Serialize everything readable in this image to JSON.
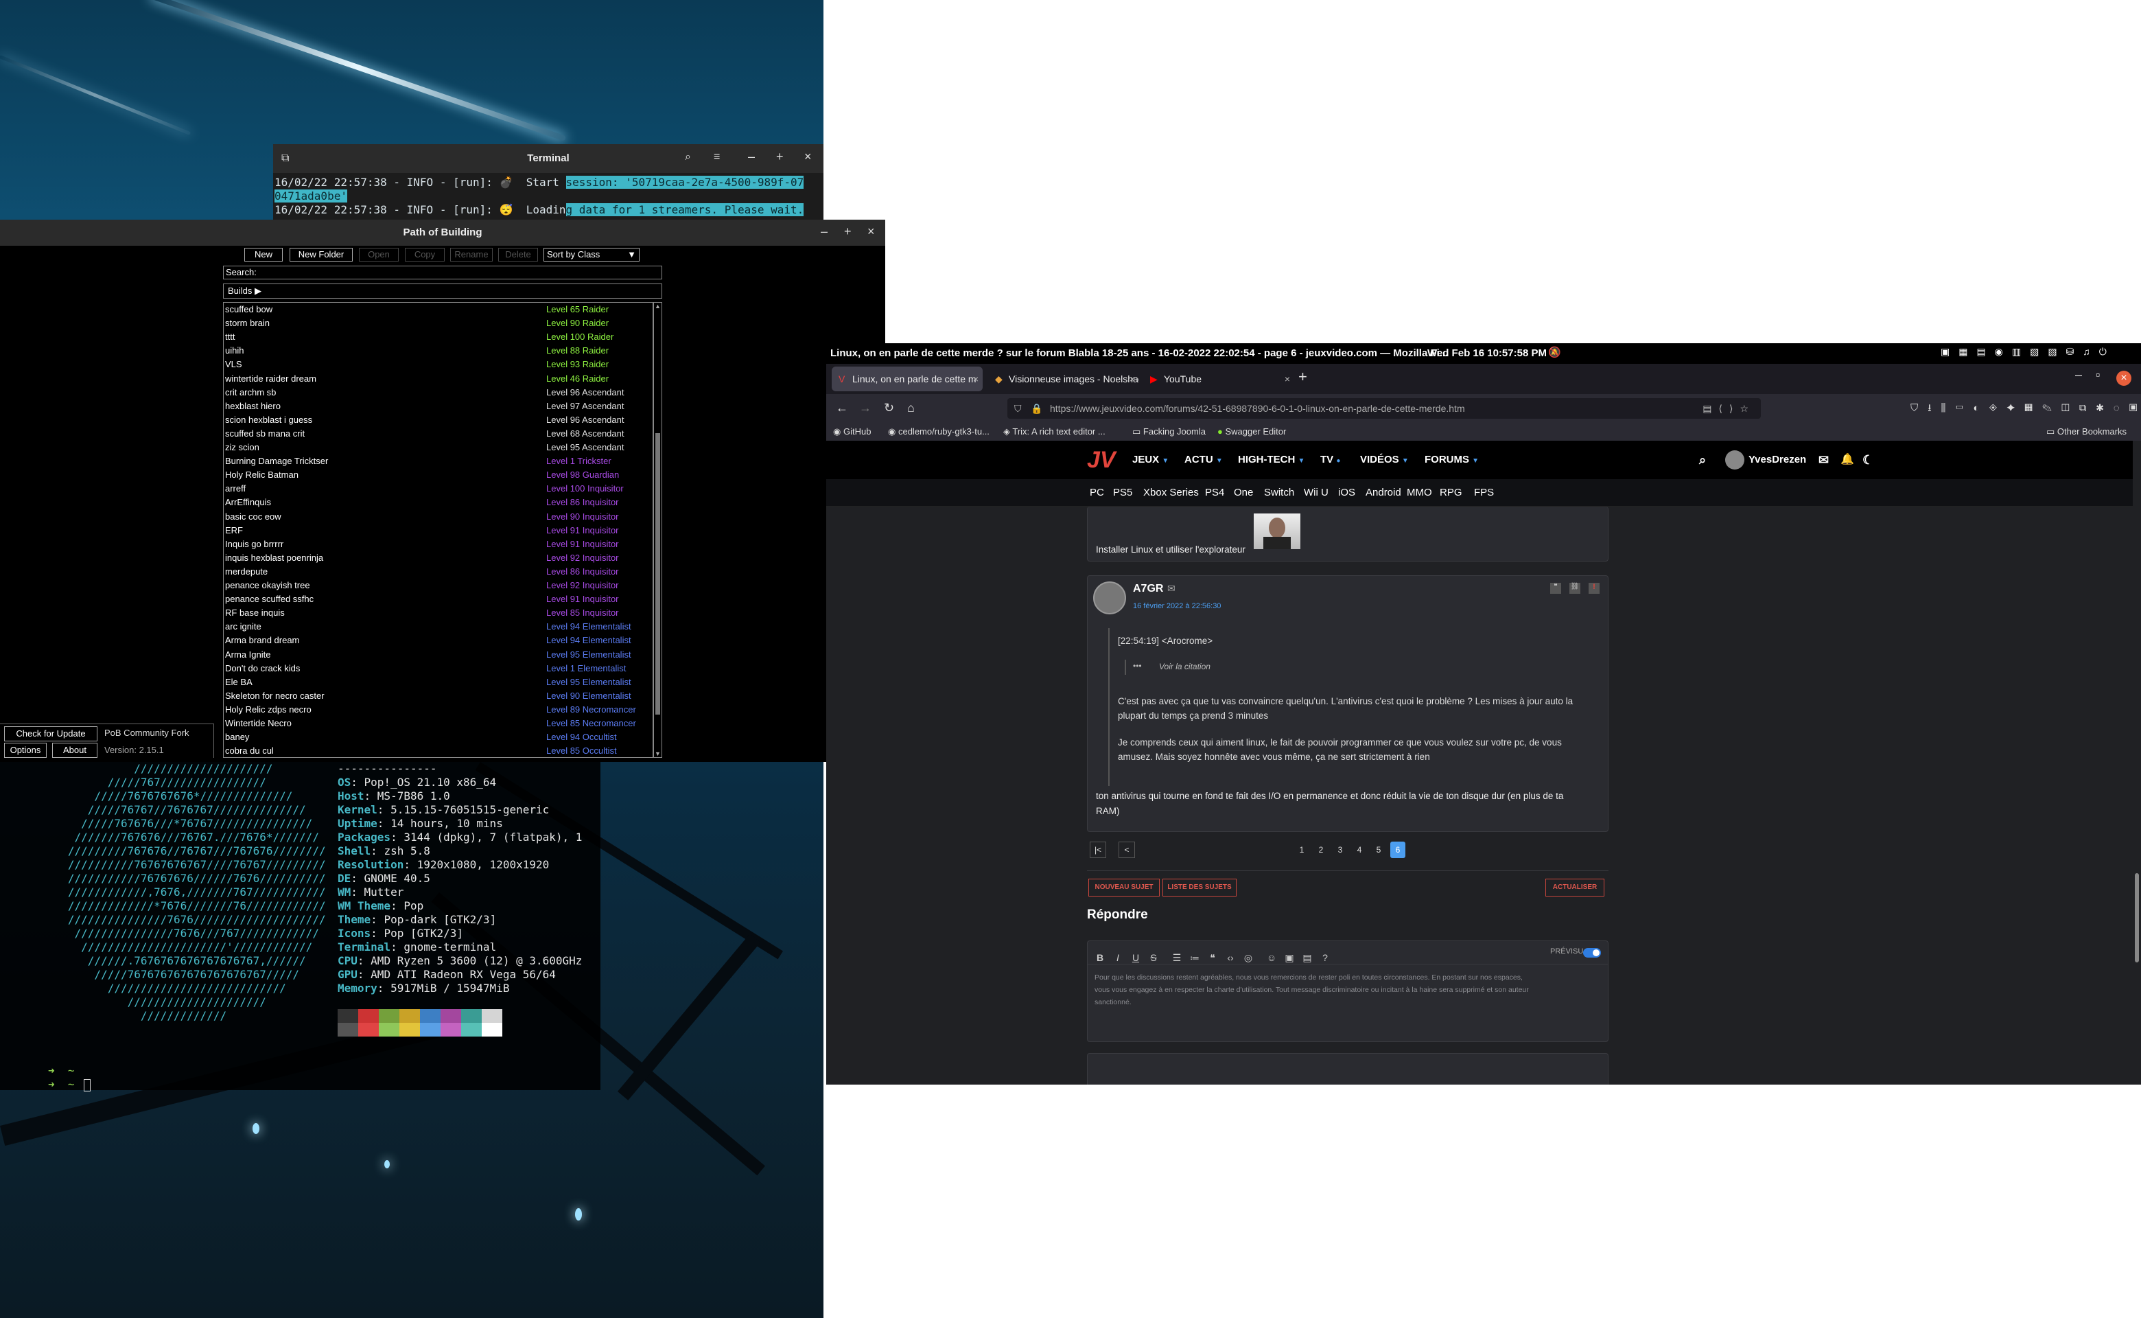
{
  "terminal": {
    "title": "Terminal",
    "lines": [
      {
        "pre": "16/02/22 22:57:38 - INFO - [run]: 💣  Start ",
        "hl": "session: '50719caa-2e7a-4500-989f-07"
      },
      {
        "pre": "",
        "hl": "0471ada0be'"
      },
      {
        "pre": "16/02/22 22:57:38 - INFO - [run]: 😴  Loadin",
        "hl": "g data for 1 streamers. Please wait."
      }
    ]
  },
  "pob": {
    "title": "Path of Building",
    "buttons": {
      "new": "New",
      "new_folder": "New Folder",
      "open": "Open",
      "copy": "Copy",
      "rename": "Rename",
      "delete": "Delete"
    },
    "sort_select": "Sort by Class",
    "search_label": "Search:",
    "builds_label": "Builds ▶",
    "builds": [
      {
        "name": "scuffed bow",
        "level": "Level 65 Raider",
        "color": "#8ef241"
      },
      {
        "name": "storm brain",
        "level": "Level 90 Raider",
        "color": "#8ef241"
      },
      {
        "name": "tttt",
        "level": "Level 100 Raider",
        "color": "#8ef241"
      },
      {
        "name": "uihih",
        "level": "Level 88 Raider",
        "color": "#8ef241"
      },
      {
        "name": "VLS",
        "level": "Level 93 Raider",
        "color": "#8ef241"
      },
      {
        "name": "wintertide raider dream",
        "level": "Level 46 Raider",
        "color": "#8ef241"
      },
      {
        "name": "crit archm sb",
        "level": "Level 96 Ascendant",
        "color": "#e0e0e0"
      },
      {
        "name": "hexblast hiero",
        "level": "Level 97 Ascendant",
        "color": "#e0e0e0"
      },
      {
        "name": "scion hexblast i guess",
        "level": "Level 96 Ascendant",
        "color": "#e0e0e0"
      },
      {
        "name": "scuffed sb mana crit",
        "level": "Level 68 Ascendant",
        "color": "#e0e0e0"
      },
      {
        "name": "ziz scion",
        "level": "Level 95 Ascendant",
        "color": "#e0e0e0"
      },
      {
        "name": "Burning Damage Tricktser",
        "level": "Level 1 Trickster",
        "color": "#a94be6"
      },
      {
        "name": "Holy Relic Batman",
        "level": "Level 98 Guardian",
        "color": "#a94be6"
      },
      {
        "name": "arreff",
        "level": "Level 100 Inquisitor",
        "color": "#a94be6"
      },
      {
        "name": "ArrEffinquis",
        "level": "Level 86 Inquisitor",
        "color": "#a94be6"
      },
      {
        "name": "basic coc eow",
        "level": "Level 90 Inquisitor",
        "color": "#a94be6"
      },
      {
        "name": "ERF",
        "level": "Level 91 Inquisitor",
        "color": "#a94be6"
      },
      {
        "name": "Inquis go brrrrr",
        "level": "Level 91 Inquisitor",
        "color": "#a94be6"
      },
      {
        "name": "inquis hexblast poenrinja",
        "level": "Level 92 Inquisitor",
        "color": "#a94be6"
      },
      {
        "name": "merdepute",
        "level": "Level 86 Inquisitor",
        "color": "#a94be6"
      },
      {
        "name": "penance okayish tree",
        "level": "Level 92 Inquisitor",
        "color": "#a94be6"
      },
      {
        "name": "penance scuffed ssfhc",
        "level": "Level 91 Inquisitor",
        "color": "#a94be6"
      },
      {
        "name": "RF base inquis",
        "level": "Level 85 Inquisitor",
        "color": "#a94be6"
      },
      {
        "name": "arc ignite",
        "level": "Level 94 Elementalist",
        "color": "#5b7cf2"
      },
      {
        "name": "Arma brand dream",
        "level": "Level 94 Elementalist",
        "color": "#5b7cf2"
      },
      {
        "name": "Arma Ignite",
        "level": "Level 95 Elementalist",
        "color": "#5b7cf2"
      },
      {
        "name": "Don't do crack kids",
        "level": "Level 1 Elementalist",
        "color": "#5b7cf2"
      },
      {
        "name": "Ele BA",
        "level": "Level 95 Elementalist",
        "color": "#5b7cf2"
      },
      {
        "name": "Skeleton for necro caster",
        "level": "Level 90 Elementalist",
        "color": "#5b7cf2"
      },
      {
        "name": "Holy Relic zdps necro",
        "level": "Level 89 Necromancer",
        "color": "#5b7cf2"
      },
      {
        "name": "Wintertide Necro",
        "level": "Level 85 Necromancer",
        "color": "#5b7cf2"
      },
      {
        "name": "baney",
        "level": "Level 94 Occultist",
        "color": "#5b7cf2"
      },
      {
        "name": "cobra du cul",
        "level": "Level 85 Occultist",
        "color": "#5b7cf2"
      }
    ],
    "check_update": "Check for Update",
    "community": "PoB Community Fork",
    "options": "Options",
    "about": "About",
    "version": "Version: 2.15.1"
  },
  "neofetch": {
    "art": [
      "             /////////////////////",
      "         /////767////////////////",
      "       /////7676767676*//////////////",
      "      /////76767//7676767//////////////",
      "     /////767676///*76767///////////////",
      "    ///////767676///76767.///7676*///////",
      "   /////////767676//76767///767676////////",
      "   //////////76767676767////76767/////////",
      "   ///////////76767676//////7676//////////",
      "   ////////////,7676,///////767///////////",
      "   /////////////*7676///////76////////////",
      "   ///////////////7676////////////////////",
      "    ///////////////7676///767////////////",
      "     //////////////////////'////////////",
      "      //////.7676767676767676767,//////",
      "       /////767676767676767676767/////",
      "         ///////////////////////////",
      "            /////////////////////",
      "              /////////////"
    ],
    "header": "---------------",
    "info": [
      {
        "k": "OS",
        "v": "Pop!_OS 21.10 x86_64"
      },
      {
        "k": "Host",
        "v": "MS-7B86 1.0"
      },
      {
        "k": "Kernel",
        "v": "5.15.15-76051515-generic"
      },
      {
        "k": "Uptime",
        "v": "14 hours, 10 mins"
      },
      {
        "k": "Packages",
        "v": "3144 (dpkg), 7 (flatpak), 1"
      },
      {
        "k": "Shell",
        "v": "zsh 5.8"
      },
      {
        "k": "Resolution",
        "v": "1920x1080, 1200x1920"
      },
      {
        "k": "DE",
        "v": "GNOME 40.5"
      },
      {
        "k": "WM",
        "v": "Mutter"
      },
      {
        "k": "WM Theme",
        "v": "Pop"
      },
      {
        "k": "Theme",
        "v": "Pop-dark [GTK2/3]"
      },
      {
        "k": "Icons",
        "v": "Pop [GTK2/3]"
      },
      {
        "k": "Terminal",
        "v": "gnome-terminal"
      },
      {
        "k": "CPU",
        "v": "AMD Ryzen 5 3600 (12) @ 3.600GHz"
      },
      {
        "k": "GPU",
        "v": "AMD ATI Radeon RX Vega 56/64"
      },
      {
        "k": "Memory",
        "v": "5917MiB / 15947MiB"
      }
    ],
    "swatches1": [
      "#333333",
      "#cc3333",
      "#74a03b",
      "#c9a227",
      "#3d7fc4",
      "#a3479e",
      "#3a9c94",
      "#d5d5d5"
    ],
    "swatches2": [
      "#555555",
      "#e04444",
      "#8fc75a",
      "#e3c43a",
      "#5aa0e6",
      "#c463c0",
      "#57c0b6",
      "#ffffff"
    ],
    "prompt1": "➜  ~",
    "prompt2": "➜  ~ "
  },
  "gnome": {
    "window_title": "Linux, on en parle de cette merde ? sur le forum Blabla 18-25 ans - 16-02-2022 22:02:54 - page 6 - jeuxvideo.com — Mozilla Fi...",
    "clock": "Wed Feb 16  10:57:58 PM"
  },
  "browser": {
    "tabs": [
      {
        "label": "Linux, on en parle de cette m"
      },
      {
        "label": "Visionneuse images - Noelshack"
      },
      {
        "label": "YouTube"
      }
    ],
    "url": "https://www.jeuxvideo.com/forums/42-51-68987890-6-0-1-0-linux-on-en-parle-de-cette-merde.htm",
    "bookmarks": [
      "GitHub",
      "cedlemo/ruby-gtk3-tu...",
      "Trix: A rich text editor ...",
      "Facking Joomla",
      "Swagger Editor"
    ],
    "other_bookmarks": "Other Bookmarks"
  },
  "jv": {
    "menu": [
      "JEUX",
      "ACTU",
      "HIGH-TECH",
      "TV",
      "VIDÉOS",
      "FORUMS"
    ],
    "platforms": [
      "PC",
      "PS5",
      "Xbox Series",
      "PS4",
      "One",
      "Switch",
      "Wii U",
      "iOS",
      "Android",
      "MMO",
      "RPG",
      "FPS"
    ],
    "username": "YvesDrezen",
    "prev_post_text": "Installer Linux et utiliser l'explorateur",
    "post": {
      "author": "A7GR",
      "date": "16 février 2022 à 22:56:30",
      "quote_head": "[22:54:19] <Arocrome>",
      "see_quote": "Voir la citation",
      "quote_p1a": "C'est pas avec ça que tu vas convaincre quelqu'un. L'antivirus c'est quoi le problème ? Les mises à jour auto la",
      "quote_p1b": "plupart du temps ça prend 3 minutes",
      "quote_p2a": "Je comprends ceux qui aiment linux, le fait de pouvoir programmer ce que vous voulez sur votre pc, de vous",
      "quote_p2b": "amusez. Mais soyez honnête avec vous même, ça ne sert strictement à rien",
      "reply_a": "ton antivirus qui tourne en fond te fait des I/O en permanence et donc réduit la vie de ton disque dur (en plus de ta",
      "reply_b": "RAM)"
    },
    "pages": [
      "1",
      "2",
      "3",
      "4",
      "5",
      "6"
    ],
    "new_topic": "NOUVEAU SUJET",
    "topic_list": "LISTE DES SUJETS",
    "refresh": "ACTUALISER",
    "reply_title": "Répondre",
    "preview": "PRÉVISU",
    "editor_placeholder_a": "Pour que les discussions restent agréables, nous vous remercions de rester poli en toutes circonstances. En postant sur nos espaces,",
    "editor_placeholder_b": "vous vous engagez à en respecter la charte d'utilisation. Tout message discriminatoire ou incitant à la haine sera supprimé et son auteur",
    "editor_placeholder_c": "sanctionné."
  }
}
